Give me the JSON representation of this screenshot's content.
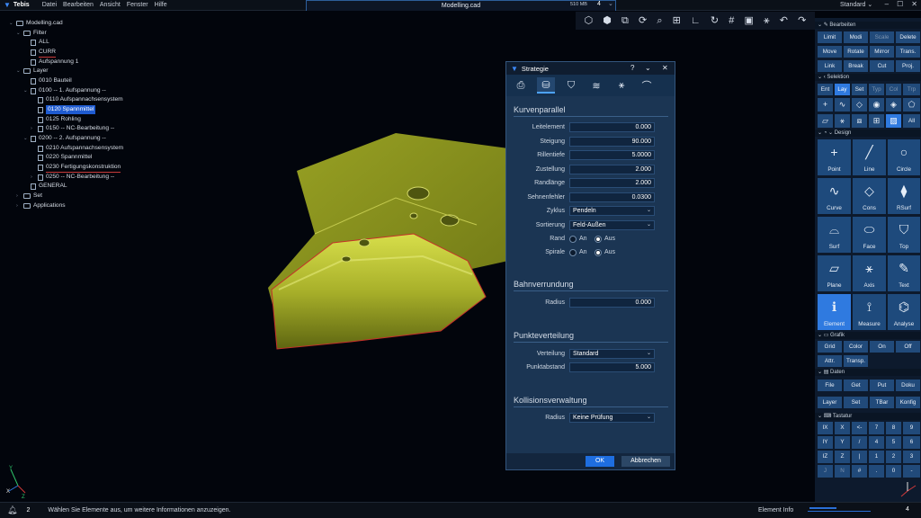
{
  "app": {
    "name": "Tebis",
    "menu": [
      "Datei",
      "Bearbeiten",
      "Ansicht",
      "Fenster",
      "Hilfe"
    ],
    "doc_title": "Modelling.cad",
    "memory": "510 MB",
    "tab_count": "4",
    "profile": "Standard"
  },
  "tree": {
    "root": "Modelling.cad",
    "filter": "Filter",
    "filter_all": "ALL",
    "filter_curr": "CURR",
    "filter_aufsp": "Aufspannung 1",
    "layer": "Layer",
    "l0010": "0010 Bauteil",
    "l0100": "0100 -- 1. Aufspannung --",
    "l0110": "0110 Aufspannachsensystem",
    "l0120": "0120 Spannmittel",
    "l0125": "0125 Rohling",
    "l0150": "0150 -- NC-Bearbeitung --",
    "l0200": "0200 -- 2. Aufspannung --",
    "l0210": "0210 Aufspannachsensystem",
    "l0220": "0220 Spannmittel",
    "l0230": "0230 Fertigungskonstruktion",
    "l0250": "0250 -- NC-Bearbeitung --",
    "general": "GENERAL",
    "set": "Set",
    "applications": "Applications"
  },
  "dialog": {
    "title": "Strategie",
    "help": "?",
    "sec1": "Kurvenparallel",
    "f_leitelement": "Leitelement",
    "v_leitelement": "0.000",
    "f_steigung": "Steigung",
    "v_steigung": "90.000",
    "f_rillentiefe": "Rillentiefe",
    "v_rillentiefe": "5.0000",
    "f_zustellung": "Zustellung",
    "v_zustellung": "2.000",
    "f_randlaenge": "Randlänge",
    "v_randlaenge": "2.000",
    "f_sehnenfehler": "Sehnenfehler",
    "v_sehnenfehler": "0.0300",
    "f_zyklus": "Zyklus",
    "v_zyklus": "Pendeln",
    "f_sortierung": "Sortierung",
    "v_sortierung": "Feld-Außen",
    "f_rand": "Rand",
    "f_spirale": "Spirale",
    "opt_an": "An",
    "opt_aus": "Aus",
    "sec2": "Bahnverrundung",
    "f_radius": "Radius",
    "v_radius": "0.000",
    "sec3": "Punkteverteilung",
    "f_verteilung": "Verteilung",
    "v_verteilung": "Standard",
    "f_punktabstand": "Punktabstand",
    "v_punktabstand": "5.000",
    "sec4": "Kollisionsverwaltung",
    "f_kradius": "Radius",
    "v_kradius": "Keine Prüfung",
    "ok": "OK",
    "cancel": "Abbrechen"
  },
  "panel": {
    "h_bearbeiten": "Bearbeiten",
    "bearbeiten": [
      "Limit",
      "Modi",
      "Scale",
      "Delete",
      "Move",
      "Rotate",
      "Mirror",
      "Trans.",
      "Link",
      "Break",
      "Cut",
      "Proj."
    ],
    "h_selektion": "Selektion",
    "selektion": [
      "Ent",
      "Lay",
      "Set",
      "Typ",
      "Col",
      "Trp"
    ],
    "all": "All",
    "h_design": "Design",
    "design": [
      "Point",
      "Line",
      "Circle",
      "Curve",
      "Cons",
      "RSurf",
      "Surf",
      "Face",
      "Top",
      "Plane",
      "Axis",
      "Text",
      "Element",
      "Measure",
      "Analyse"
    ],
    "h_grafik": "Grafik",
    "grafik": [
      "Grid",
      "Color",
      "On",
      "Off",
      "Attr.",
      "Transp."
    ],
    "h_daten": "Daten",
    "daten": [
      "File",
      "Get",
      "Put",
      "Doku",
      "Layer",
      "Set",
      "TBar",
      "Konfig"
    ],
    "h_tastatur": "Tastatur",
    "keys": [
      "IX",
      "X",
      "<-",
      "7",
      "8",
      "9",
      "IY",
      "Y",
      "/",
      "4",
      "5",
      "6",
      "IZ",
      "Z",
      "|",
      "1",
      "2",
      "3",
      "J",
      "N",
      "#",
      ".",
      "0",
      "-"
    ]
  },
  "status": {
    "count": "2",
    "message": "Wählen Sie Elemente aus, um weitere Informationen anzuzeigen.",
    "element_info": "Element Info",
    "right_num": "4"
  },
  "colors": {
    "accent": "#2f7ae0",
    "part": "#b4be2c",
    "dialog": "#1b3553"
  }
}
